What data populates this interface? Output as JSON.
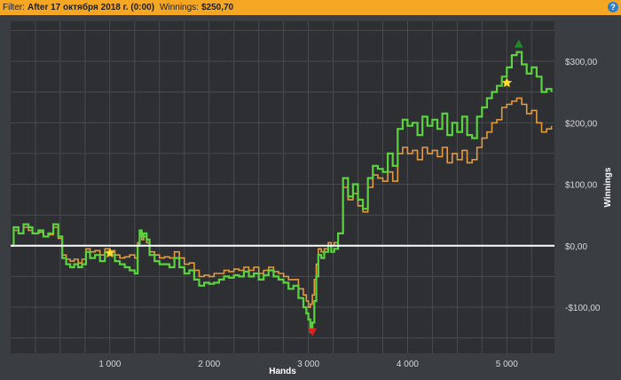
{
  "header": {
    "filter_label": "Filter:",
    "filter_value": "After 17 октября 2018 г. (0:00)",
    "winnings_label": "Winnings:",
    "winnings_value": "$250,70",
    "help_icon": "help-icon"
  },
  "chart_data": {
    "type": "line",
    "xlabel": "Hands",
    "ylabel": "Winnings",
    "xlim": [
      0,
      5480
    ],
    "ylim": [
      -175,
      365
    ],
    "x_ticks": [
      1000,
      2000,
      3000,
      4000,
      5000
    ],
    "x_tick_labels": [
      "1 000",
      "2 000",
      "3 000",
      "4 000",
      "5 000"
    ],
    "y_ticks": [
      300,
      200,
      100,
      0,
      -100
    ],
    "y_tick_labels": [
      "$300,00",
      "$200,00",
      "$100,00",
      "$0,00",
      "-$100,00"
    ],
    "grid": true,
    "zero_line": true,
    "colors": {
      "background": "#2d2f33",
      "grid": "#474a50",
      "winnings": "#5ad43d",
      "allin_ev": "#e59a3f",
      "zero_line": "#ffffff",
      "star": "#ffe033",
      "max_marker": "#1f8a2a",
      "min_marker": "#e02020"
    },
    "series": [
      {
        "x": [
          0,
          30,
          80,
          130,
          180,
          220,
          280,
          330,
          380,
          430,
          480,
          520,
          560,
          600,
          640,
          680,
          720,
          760,
          800,
          850,
          900,
          950,
          1000,
          1050,
          1100,
          1150,
          1200,
          1250,
          1280,
          1300,
          1320,
          1340,
          1370,
          1400,
          1450,
          1500,
          1550,
          1600,
          1650,
          1700,
          1750,
          1800,
          1850,
          1900,
          1950,
          2000,
          2050,
          2100,
          2150,
          2200,
          2250,
          2300,
          2350,
          2400,
          2450,
          2500,
          2550,
          2600,
          2650,
          2700,
          2750,
          2800,
          2850,
          2900,
          2950,
          2980,
          3000,
          3020,
          3040,
          3060,
          3080,
          3100,
          3130,
          3160,
          3200,
          3230,
          3260,
          3300,
          3350,
          3400,
          3450,
          3500,
          3550,
          3600,
          3650,
          3700,
          3750,
          3800,
          3850,
          3900,
          3950,
          4000,
          4050,
          4100,
          4150,
          4200,
          4250,
          4300,
          4350,
          4400,
          4450,
          4500,
          4550,
          4600,
          4650,
          4700,
          4750,
          4800,
          4850,
          4900,
          4950,
          5000,
          5050,
          5100,
          5150,
          5200,
          5250,
          5300,
          5350,
          5400,
          5450
        ],
        "y": [
          0,
          30,
          20,
          35,
          30,
          20,
          25,
          15,
          20,
          35,
          15,
          -20,
          -30,
          -35,
          -30,
          -35,
          -30,
          -10,
          -20,
          -15,
          -25,
          -10,
          -15,
          -25,
          -30,
          -35,
          -40,
          -45,
          0,
          25,
          15,
          20,
          10,
          -15,
          -25,
          -30,
          -30,
          -35,
          -20,
          -35,
          -45,
          -40,
          -55,
          -65,
          -60,
          -62,
          -60,
          -55,
          -50,
          -52,
          -48,
          -50,
          -42,
          -50,
          -45,
          -55,
          -48,
          -40,
          -50,
          -55,
          -60,
          -70,
          -65,
          -85,
          -100,
          -110,
          -120,
          -140,
          -125,
          -90,
          -50,
          -15,
          -20,
          -10,
          0,
          -10,
          -5,
          20,
          110,
          80,
          100,
          75,
          60,
          110,
          130,
          125,
          120,
          150,
          130,
          190,
          205,
          195,
          200,
          180,
          210,
          195,
          205,
          190,
          215,
          180,
          200,
          185,
          210,
          180,
          175,
          210,
          225,
          240,
          250,
          260,
          275,
          290,
          310,
          315,
          295,
          280,
          290,
          275,
          250,
          255,
          250
        ]
      },
      {
        "x": [
          0,
          30,
          80,
          130,
          180,
          220,
          280,
          330,
          380,
          430,
          480,
          520,
          560,
          600,
          640,
          680,
          720,
          760,
          800,
          850,
          900,
          950,
          1000,
          1050,
          1100,
          1150,
          1200,
          1250,
          1280,
          1300,
          1320,
          1340,
          1370,
          1400,
          1450,
          1500,
          1550,
          1600,
          1650,
          1700,
          1750,
          1800,
          1850,
          1900,
          1950,
          2000,
          2050,
          2100,
          2150,
          2200,
          2250,
          2300,
          2350,
          2400,
          2450,
          2500,
          2550,
          2600,
          2650,
          2700,
          2750,
          2800,
          2850,
          2900,
          2950,
          2980,
          3000,
          3020,
          3040,
          3060,
          3080,
          3100,
          3130,
          3160,
          3200,
          3230,
          3260,
          3300,
          3350,
          3400,
          3450,
          3500,
          3550,
          3600,
          3650,
          3700,
          3750,
          3800,
          3850,
          3900,
          3950,
          4000,
          4050,
          4100,
          4150,
          4200,
          4250,
          4300,
          4350,
          4400,
          4450,
          4500,
          4550,
          4600,
          4650,
          4700,
          4750,
          4800,
          4850,
          4900,
          4950,
          5000,
          5050,
          5100,
          5150,
          5200,
          5250,
          5300,
          5350,
          5400,
          5450
        ],
        "y": [
          0,
          25,
          20,
          30,
          25,
          20,
          22,
          15,
          18,
          30,
          12,
          -15,
          -22,
          -25,
          -22,
          -28,
          -22,
          -5,
          -10,
          -8,
          -15,
          -5,
          -8,
          -15,
          -20,
          -18,
          -15,
          -20,
          5,
          20,
          10,
          15,
          5,
          -10,
          -15,
          -20,
          -18,
          -20,
          -10,
          -20,
          -30,
          -28,
          -40,
          -50,
          -48,
          -50,
          -45,
          -45,
          -40,
          -42,
          -38,
          -40,
          -35,
          -40,
          -35,
          -45,
          -40,
          -35,
          -42,
          -45,
          -50,
          -55,
          -55,
          -70,
          -80,
          -90,
          -100,
          -95,
          -80,
          -55,
          -30,
          -5,
          -10,
          -5,
          5,
          0,
          5,
          20,
          95,
          75,
          85,
          65,
          55,
          95,
          115,
          110,
          105,
          120,
          105,
          150,
          160,
          150,
          155,
          140,
          160,
          150,
          155,
          145,
          160,
          135,
          150,
          140,
          155,
          135,
          140,
          160,
          175,
          185,
          200,
          205,
          225,
          230,
          235,
          240,
          230,
          215,
          220,
          200,
          185,
          190,
          195
        ]
      }
    ],
    "annotations": [
      {
        "type": "star",
        "x": 1000,
        "y": -12
      },
      {
        "type": "star",
        "x": 5000,
        "y": 265
      },
      {
        "type": "max",
        "x": 5120,
        "y": 328
      },
      {
        "type": "min",
        "x": 3040,
        "y": -140
      }
    ]
  }
}
